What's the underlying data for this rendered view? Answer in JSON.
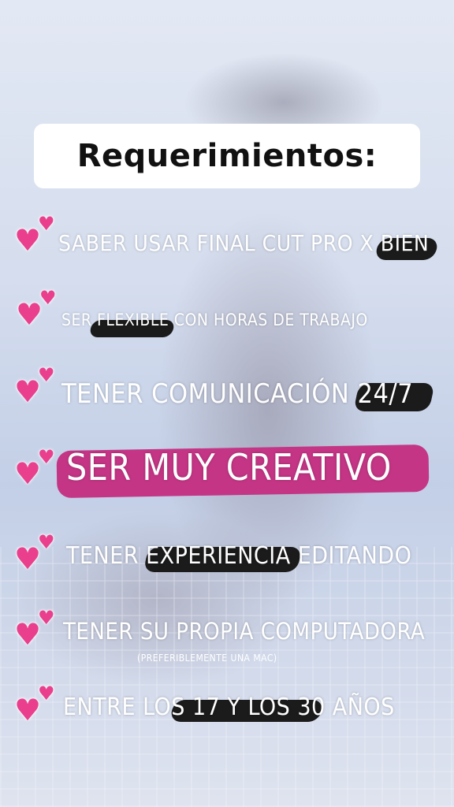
{
  "title": "Requerimientos:",
  "items": [
    {
      "text": "SABER USAR FINAL CUT PRO X BIEN",
      "icon": "two-hearts-icon"
    },
    {
      "text": "SER FLEXIBLE CON HORAS DE  TRABAJO",
      "icon": "two-hearts-icon"
    },
    {
      "text": "TENER COMUNICACIÓN 24/7",
      "icon": "two-hearts-icon"
    },
    {
      "text": "SER MUY CREATIVO",
      "icon": "two-hearts-icon"
    },
    {
      "text": "TENER EXPERIENCIA EDITANDO",
      "icon": "two-hearts-icon"
    },
    {
      "text": "TENER SU PROPIA COMPUTADORA",
      "icon": "two-hearts-icon",
      "note": "(PREFERIBLEMENTE UNA MAC)"
    },
    {
      "text": "ENTRE LOS 17 Y LOS 30 AÑOS",
      "icon": "two-hearts-icon"
    }
  ],
  "colors": {
    "heart": "#e93f8c",
    "highlight_pink": "#c43585",
    "highlight_dark": "#1b1b1b"
  }
}
